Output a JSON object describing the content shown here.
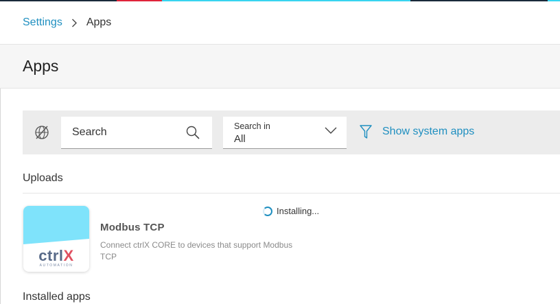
{
  "breadcrumb": {
    "parent": "Settings",
    "current": "Apps"
  },
  "page": {
    "title": "Apps"
  },
  "toolbar": {
    "search_placeholder": "Search",
    "search_in_label": "Search in",
    "search_in_value": "All",
    "show_system_apps": "Show system apps"
  },
  "sections": {
    "uploads": "Uploads",
    "installed": "Installed apps"
  },
  "upload_app": {
    "logo_text_main": "ctrl",
    "logo_text_accent": "X",
    "logo_subtext": "AUTOMATION",
    "name": "Modbus TCP",
    "description": "Connect ctrlX CORE to devices that support Modbus TCP",
    "status": "Installing..."
  },
  "colors": {
    "accent": "#1f8fc0",
    "logo_bg": "#7fe3fb",
    "brand_x": "#e05060"
  }
}
